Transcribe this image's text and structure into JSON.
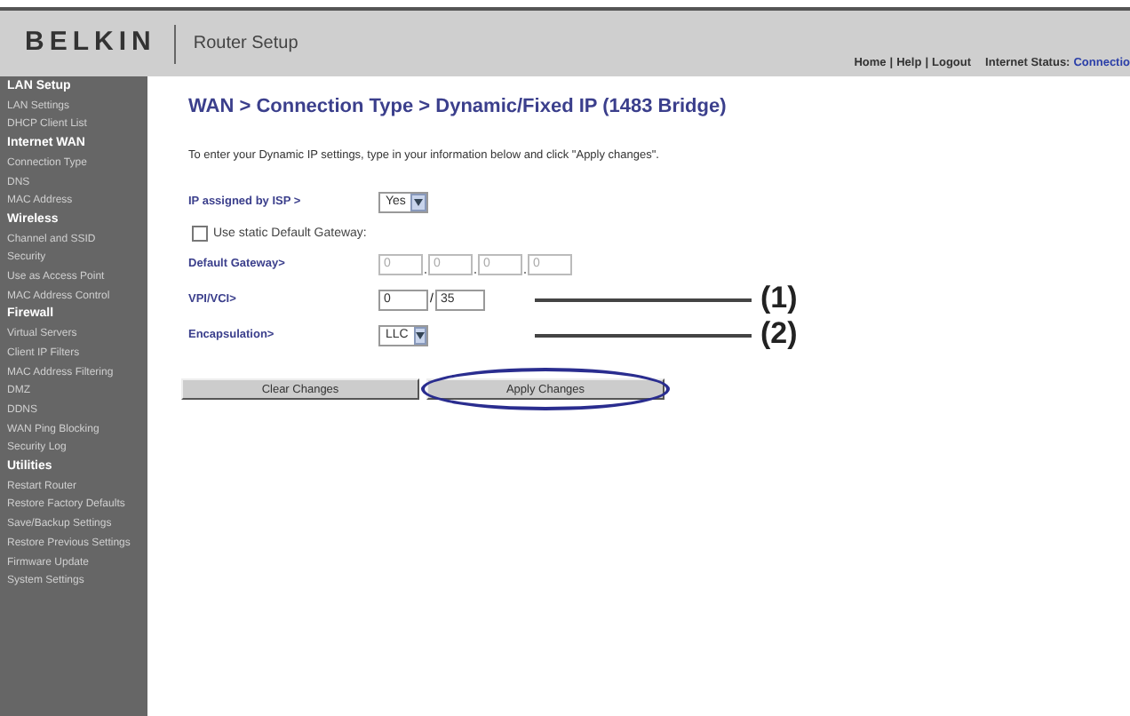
{
  "header": {
    "logo": "BELKIN",
    "title": "Router Setup",
    "links": [
      "Home",
      "|",
      "Help",
      "|",
      "Logout"
    ],
    "status_label": "Internet Status:",
    "status_value": "Connectio"
  },
  "sidebar": {
    "sections": [
      {
        "heading": "LAN Setup",
        "items": [
          "LAN Settings",
          "DHCP Client List"
        ]
      },
      {
        "heading": "Internet WAN",
        "items": [
          "Connection Type",
          "DNS",
          "MAC Address"
        ]
      },
      {
        "heading": "Wireless",
        "items": [
          "Channel and SSID",
          "Security",
          "Use as Access Point",
          "MAC Address Control"
        ]
      },
      {
        "heading": "Firewall",
        "items": [
          "Virtual Servers",
          "Client IP Filters",
          "MAC Address Filtering",
          "DMZ",
          "DDNS",
          "WAN Ping Blocking",
          "Security Log"
        ]
      },
      {
        "heading": "Utilities",
        "items": [
          "Restart Router",
          "Restore Factory Defaults",
          "Save/Backup Settings",
          "Restore Previous Settings",
          "Firmware Update",
          "System Settings"
        ]
      }
    ]
  },
  "page": {
    "title": "WAN > Connection Type > Dynamic/Fixed IP (1483 Bridge)",
    "instruction": "To enter your Dynamic IP settings, type in your information below and click \"Apply changes\".",
    "fields": [
      {
        "kind": "select",
        "label": "IP assigned by ISP >",
        "value": "Yes"
      },
      {
        "kind": "checkbox",
        "label": "Use static Default Gateway:",
        "checked": false
      },
      {
        "kind": "octets",
        "label": "Default Gateway>",
        "values": [
          "0",
          "0",
          "0",
          "0"
        ],
        "disabled": true
      },
      {
        "kind": "pair",
        "label": "VPI/VCI>",
        "values": [
          "0",
          "35"
        ],
        "separator": "/",
        "callout": "(1)"
      },
      {
        "kind": "select",
        "label": "Encapsulation>",
        "value": "LLC",
        "callout": "(2)"
      }
    ],
    "buttons": [
      {
        "label": "Clear Changes",
        "highlighted": false
      },
      {
        "label": "Apply Changes",
        "highlighted": true
      }
    ]
  }
}
